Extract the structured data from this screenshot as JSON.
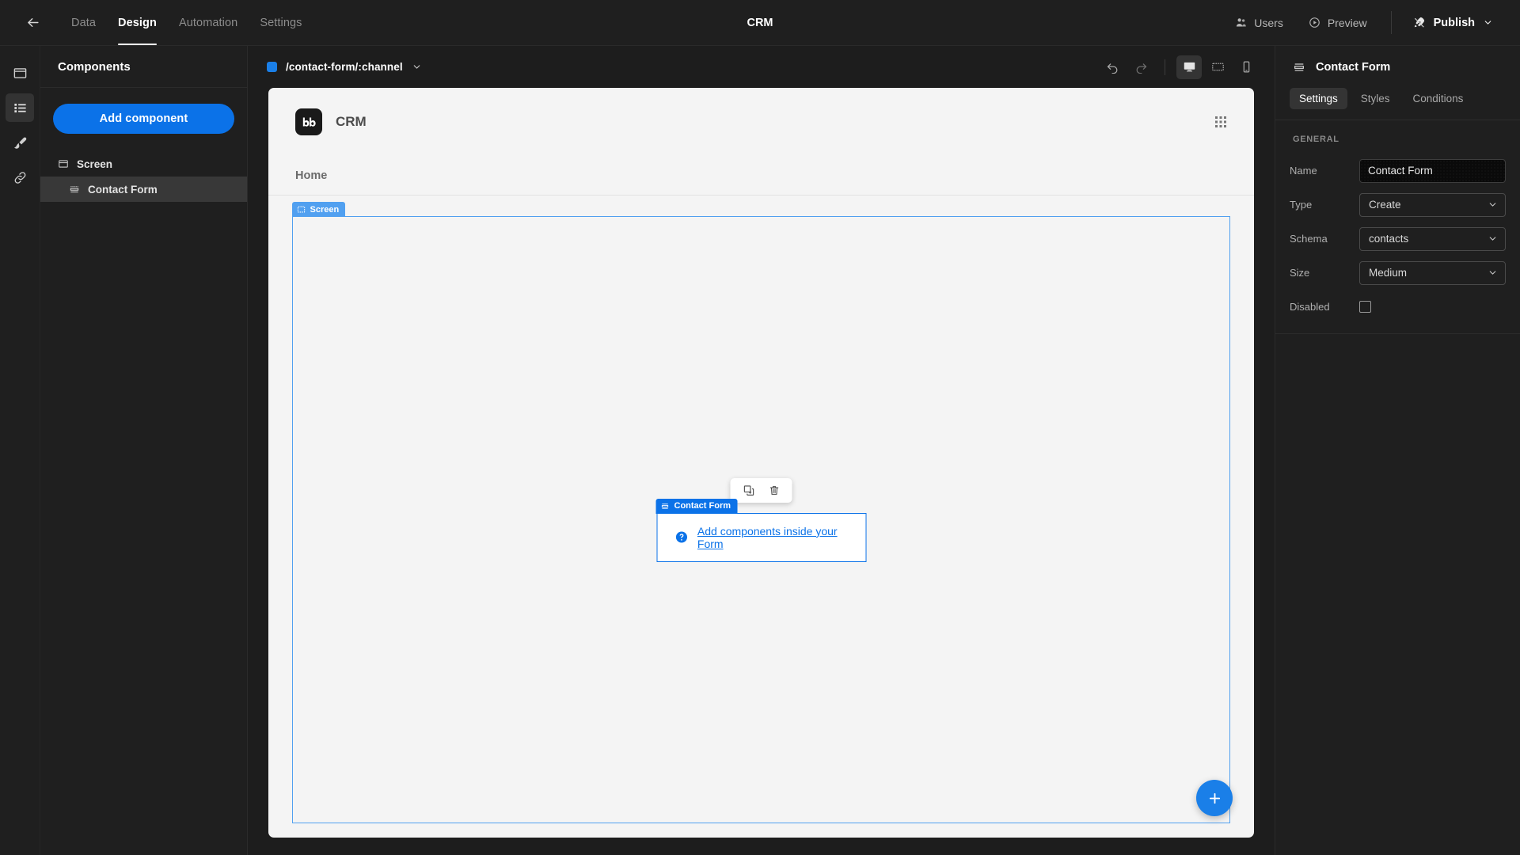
{
  "topbar": {
    "back_icon": "arrow-left-icon",
    "tabs": [
      {
        "label": "Data",
        "active": false
      },
      {
        "label": "Design",
        "active": true
      },
      {
        "label": "Automation",
        "active": false
      },
      {
        "label": "Settings",
        "active": false
      }
    ],
    "title": "CRM",
    "users_label": "Users",
    "preview_label": "Preview",
    "publish_label": "Publish"
  },
  "rail": {
    "items": [
      {
        "icon": "screen-icon",
        "active": false
      },
      {
        "icon": "components-list-icon",
        "active": true
      },
      {
        "icon": "paintbrush-icon",
        "active": false
      },
      {
        "icon": "link-icon",
        "active": false
      }
    ]
  },
  "components_panel": {
    "title": "Components",
    "add_button": "Add component",
    "tree": [
      {
        "label": "Screen",
        "icon": "screen-icon",
        "selected": false,
        "child": false
      },
      {
        "label": "Contact Form",
        "icon": "form-icon",
        "selected": true,
        "child": true
      }
    ]
  },
  "workspace": {
    "route": "/contact-form/:channel",
    "route_color": "#1a7fe8",
    "tools": [
      {
        "name": "undo-icon"
      },
      {
        "name": "redo-icon"
      },
      {
        "name": "desktop-icon",
        "active": true
      },
      {
        "name": "tablet-icon",
        "active": false
      },
      {
        "name": "mobile-icon",
        "active": false
      }
    ]
  },
  "canvas": {
    "logo_text": "bb",
    "app_name": "CRM",
    "nav_link": "Home",
    "screen_badge": "Screen",
    "screen_badge_color": "#51a0f0",
    "form_badge": "Contact Form",
    "form_badge_color": "#0b72e8",
    "form_hint": "Add components inside your Form",
    "toolbar_icons": [
      "duplicate-icon",
      "trash-icon"
    ],
    "fab_icon": "plus-icon"
  },
  "properties": {
    "title": "Contact Form",
    "tabs": [
      {
        "label": "Settings",
        "active": true
      },
      {
        "label": "Styles",
        "active": false
      },
      {
        "label": "Conditions",
        "active": false
      }
    ],
    "section": "GENERAL",
    "fields": {
      "name_label": "Name",
      "name_value": "Contact Form",
      "type_label": "Type",
      "type_value": "Create",
      "schema_label": "Schema",
      "schema_value": "contacts",
      "size_label": "Size",
      "size_value": "Medium",
      "disabled_label": "Disabled",
      "disabled_checked": false
    }
  }
}
